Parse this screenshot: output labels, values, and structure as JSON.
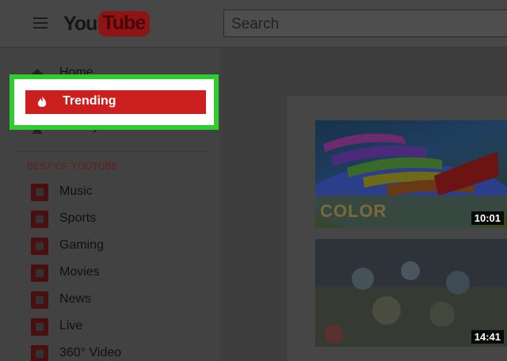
{
  "header": {
    "logo_you": "You",
    "logo_tube": "Tube",
    "search_placeholder": "Search"
  },
  "sidebar": {
    "top_items": [
      {
        "label": "Home",
        "icon": "home-icon"
      },
      {
        "label": "Trending",
        "icon": "flame-icon"
      },
      {
        "label": "History",
        "icon": "hourglass-icon"
      }
    ],
    "section_title": "BEST OF YOUTUBE",
    "categories": [
      {
        "label": "Music",
        "icon": "music-icon"
      },
      {
        "label": "Sports",
        "icon": "sports-icon"
      },
      {
        "label": "Gaming",
        "icon": "gaming-icon"
      },
      {
        "label": "Movies",
        "icon": "movies-icon"
      },
      {
        "label": "News",
        "icon": "news-icon"
      },
      {
        "label": "Live",
        "icon": "live-icon"
      },
      {
        "label": "360° Video",
        "icon": "video-360-icon"
      }
    ]
  },
  "main": {
    "videos": [
      {
        "duration": "10:01",
        "overlay_text": "COLOR"
      },
      {
        "duration": "14:41"
      }
    ]
  },
  "colors": {
    "highlight_frame": "#2ecc2e",
    "trending_bar": "#cc1f1f",
    "overlay": "#3b3b3b"
  }
}
